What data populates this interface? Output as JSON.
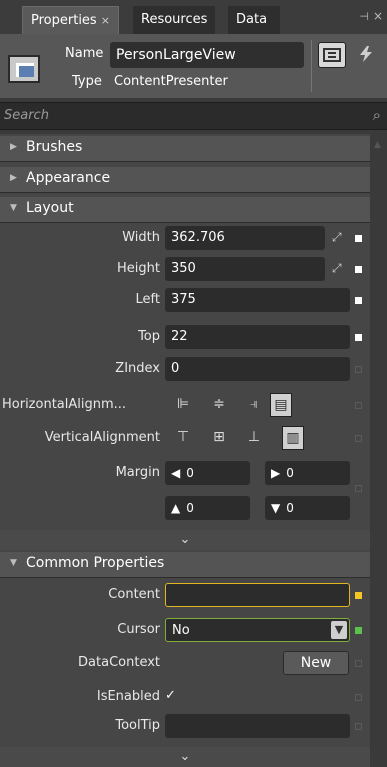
{
  "tabs": [
    {
      "label": "Properties",
      "close": "×",
      "active": true
    },
    {
      "label": "Resources",
      "active": false
    },
    {
      "label": "Data",
      "active": false
    }
  ],
  "window_controls": {
    "pin": "⊣",
    "close": "×"
  },
  "object": {
    "name_label": "Name",
    "name_value": "PersonLargeView",
    "type_label": "Type",
    "type_value": "ContentPresenter",
    "props_btn_icon": "properties-icon",
    "events_btn_icon": "lightning-icon"
  },
  "search": {
    "placeholder": "Search",
    "icon": "search-icon"
  },
  "sections": {
    "brushes": "Brushes",
    "appearance": "Appearance",
    "layout": "Layout",
    "common": "Common Properties"
  },
  "layout": {
    "width_label": "Width",
    "width_value": "362.706",
    "height_label": "Height",
    "height_value": "350",
    "left_label": "Left",
    "left_value": "375",
    "top_label": "Top",
    "top_value": "22",
    "zindex_label": "ZIndex",
    "zindex_value": "0",
    "halign_label": "HorizontalAlignm...",
    "valign_label": "VerticalAlignment",
    "margin_label": "Margin",
    "margin": {
      "left": "0",
      "right": "0",
      "top": "0",
      "bottom": "0"
    },
    "more": "⌄"
  },
  "common": {
    "content_label": "Content",
    "content_value": "",
    "cursor_label": "Cursor",
    "cursor_value": "No",
    "datacontext_label": "DataContext",
    "datacontext_button": "New",
    "isenabled_label": "IsEnabled",
    "isenabled_value": "✓",
    "tooltip_label": "ToolTip",
    "tooltip_value": "",
    "more": "⌄"
  },
  "colors": {
    "accent_yellow": "#f3c623",
    "accent_green": "#5ec14f"
  }
}
